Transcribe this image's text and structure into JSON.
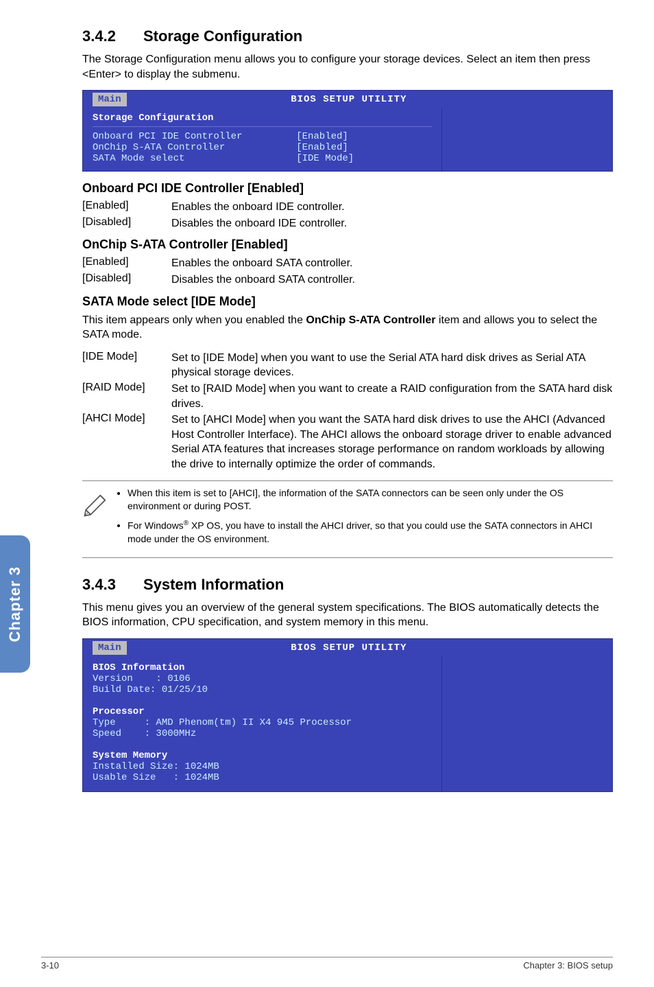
{
  "section342": {
    "num": "3.4.2",
    "title": "Storage Configuration",
    "intro": "The Storage Configuration menu allows you to configure your storage devices. Select an item then press <Enter> to display the submenu."
  },
  "bios1": {
    "title": "BIOS SETUP UTILITY",
    "tab": "Main",
    "heading": "Storage Configuration",
    "rows": [
      {
        "k": "Onboard PCI IDE Controller",
        "v": "[Enabled]"
      },
      {
        "k": "OnChip S-ATA Controller",
        "v": "[Enabled]"
      },
      {
        "k": "SATA Mode select",
        "v": "[IDE Mode]"
      }
    ]
  },
  "onboard": {
    "heading": "Onboard PCI IDE Controller [Enabled]",
    "rows": [
      {
        "k": "[Enabled]",
        "v": "Enables the onboard IDE controller."
      },
      {
        "k": "[Disabled]",
        "v": "Disables the onboard IDE controller."
      }
    ]
  },
  "onchip": {
    "heading": "OnChip S-ATA Controller [Enabled]",
    "rows": [
      {
        "k": "[Enabled]",
        "v": "Enables the onboard SATA controller."
      },
      {
        "k": "[Disabled]",
        "v": "Disables the onboard SATA controller."
      }
    ]
  },
  "satamode": {
    "heading": "SATA Mode select [IDE Mode]",
    "intro_a": "This item appears only when you enabled the ",
    "intro_bold": "OnChip S-ATA Controller",
    "intro_b": " item and allows you to select the SATA mode.",
    "rows": [
      {
        "k": "[IDE Mode]",
        "v": "Set to [IDE Mode] when you want to use the Serial ATA hard disk drives as Serial ATA physical storage devices."
      },
      {
        "k": "[RAID Mode]",
        "v": "Set to [RAID Mode] when you want to create a RAID configuration from the SATA hard disk drives."
      },
      {
        "k": "[AHCI Mode]",
        "v": "Set to [AHCI Mode] when you want the SATA hard disk drives to use the AHCI (Advanced Host Controller Interface). The AHCI allows the onboard storage driver to enable advanced Serial ATA features that increases storage performance on random workloads by allowing the drive to internally optimize the order of commands."
      }
    ]
  },
  "notes": {
    "item1": "When this item is set to [AHCI], the information of the SATA connectors can be seen only under the OS environment or during POST.",
    "item2_a": "For Windows",
    "item2_sup": "®",
    "item2_b": " XP OS, you have to install the AHCI driver, so that you could use the SATA connectors in AHCI mode under the OS environment."
  },
  "section343": {
    "num": "3.4.3",
    "title": "System Information",
    "intro": "This menu gives you an overview of the general system specifications. The BIOS automatically detects the BIOS information, CPU specification, and system memory in this menu."
  },
  "bios2": {
    "title": "BIOS SETUP UTILITY",
    "tab": "Main",
    "l1": "BIOS Information",
    "l2": "Version    : 0106",
    "l3": "Build Date: 01/25/10",
    "l4": "Processor",
    "l5": "Type     : AMD Phenom(tm) II X4 945 Processor",
    "l6": "Speed    : 3000MHz",
    "l7": "System Memory",
    "l8": "Installed Size: 1024MB",
    "l9": "Usable Size   : 1024MB"
  },
  "sidetab": "Chapter 3",
  "footer": {
    "left": "3-10",
    "right": "Chapter 3: BIOS setup"
  }
}
